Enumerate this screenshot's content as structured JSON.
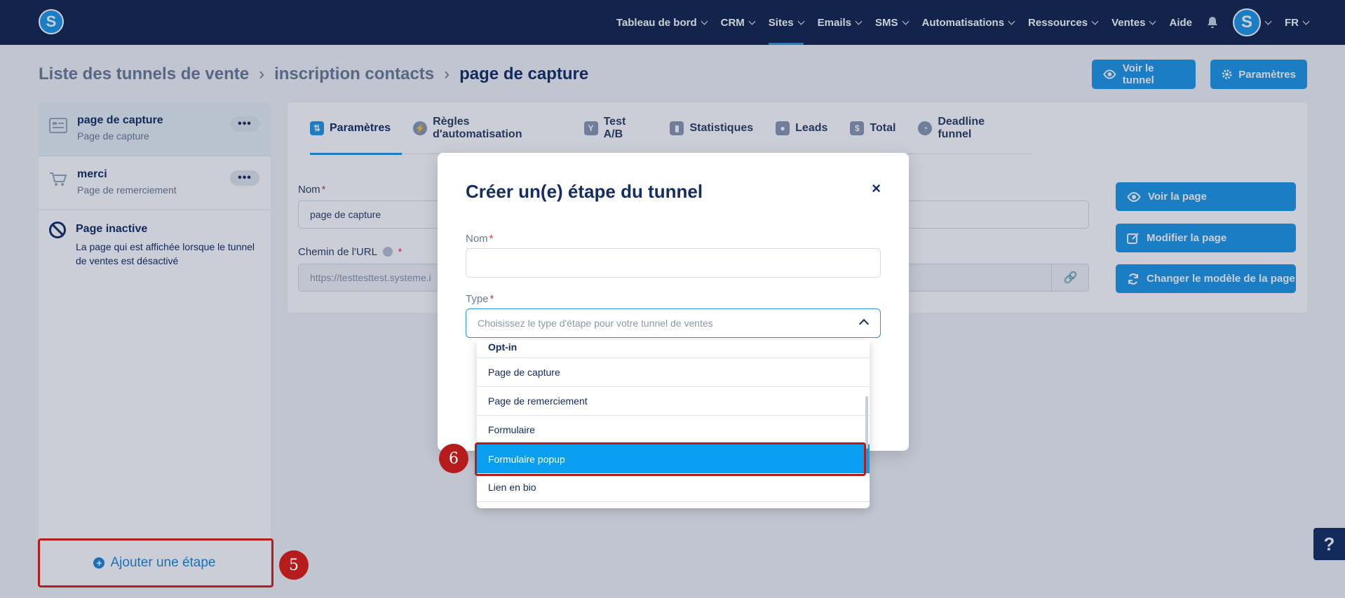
{
  "nav": {
    "items": [
      {
        "label": "Tableau de bord",
        "dropdown": true
      },
      {
        "label": "CRM",
        "dropdown": true
      },
      {
        "label": "Sites",
        "dropdown": true,
        "active": true
      },
      {
        "label": "Emails",
        "dropdown": true
      },
      {
        "label": "SMS",
        "dropdown": true
      },
      {
        "label": "Automatisations",
        "dropdown": true
      },
      {
        "label": "Ressources",
        "dropdown": true
      },
      {
        "label": "Ventes",
        "dropdown": true
      },
      {
        "label": "Aide",
        "dropdown": false
      }
    ],
    "logo_letter": "S",
    "avatar_letter": "S",
    "language": "FR",
    "bell_icon": "bell-icon"
  },
  "breadcrumb": {
    "items": [
      "Liste des tunnels de vente",
      "inscription contacts",
      "page de capture"
    ]
  },
  "header_buttons": {
    "view_funnel": "Voir le tunnel",
    "settings": "Paramètres"
  },
  "sidebar": {
    "steps": [
      {
        "title": "page de capture",
        "subtitle": "Page de capture",
        "icon": "page-icon"
      },
      {
        "title": "merci",
        "subtitle": "Page de remerciement",
        "icon": "cart-icon"
      }
    ],
    "more_label": "•••",
    "inactive": {
      "title": "Page inactive",
      "text": "La page qui est affichée lorsque le tunnel de ventes est désactivé"
    },
    "add_step": "Ajouter une étape"
  },
  "tabs": [
    {
      "label": "Paramètres",
      "active": true
    },
    {
      "label": "Règles d'automatisation"
    },
    {
      "label": "Test A/B"
    },
    {
      "label": "Statistiques"
    },
    {
      "label": "Leads"
    },
    {
      "label": "Total"
    },
    {
      "label": "Deadline funnel"
    }
  ],
  "form": {
    "name_label": "Nom",
    "name_value": "page de capture",
    "url_label": "Chemin de l'URL",
    "url_value": "https://testtesttest.systeme.i"
  },
  "page_actions": {
    "view_page": "Voir la page",
    "edit_page": "Modifier la page",
    "change_template": "Changer le modèle de la page"
  },
  "modal": {
    "title": "Créer un(e) étape du tunnel",
    "close": "×",
    "name_label": "Nom",
    "type_label": "Type",
    "type_placeholder": "Choisissez le type d'étape pour votre tunnel de ventes",
    "dropdown": {
      "group": "Opt-in",
      "options": [
        "Page de capture",
        "Page de remerciement",
        "Formulaire",
        "Formulaire popup",
        "Lien en bio"
      ],
      "highlighted": "Formulaire popup"
    }
  },
  "annotations": {
    "step5": "5",
    "step6": "6"
  },
  "help": "?",
  "colors": {
    "navbar": "#12264d",
    "accent": "#1e98e8",
    "highlight_option": "#0a9ef0",
    "annotation": "#b71c1c"
  }
}
